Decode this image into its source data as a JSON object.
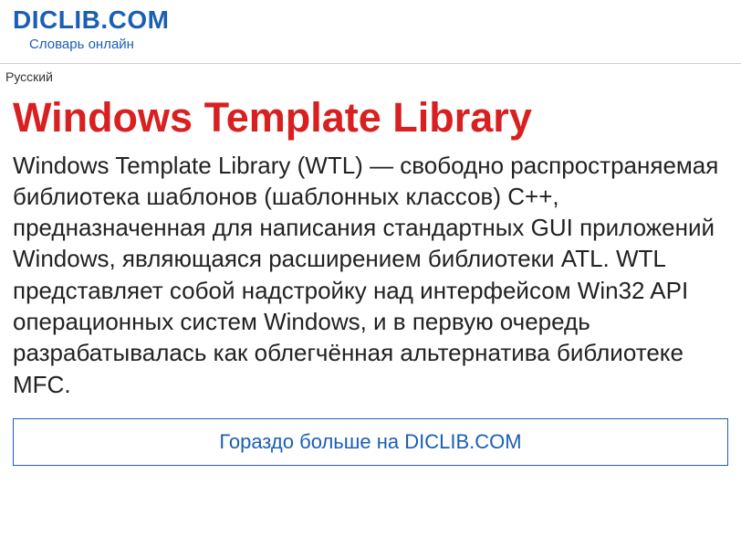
{
  "header": {
    "site_name": "DICLIB.COM",
    "tagline": "Словарь онлайн"
  },
  "language": "Русский",
  "article": {
    "title": "Windows Template Library",
    "body": "Windows Template Library (WTL) — свободно распространяемая библиотека шаблонов (шаблонных классов) C++, предназначенная для написания стандартных GUI приложений Windows, являющаяся расширением библиотеки ATL. WTL представляет собой надстройку над интерфейсом Win32 API операционных систем Windows, и в первую очередь разрабатывалась как облегчённая альтернатива библиотеке MFC."
  },
  "more_link": "Гораздо больше на DICLIB.COM"
}
